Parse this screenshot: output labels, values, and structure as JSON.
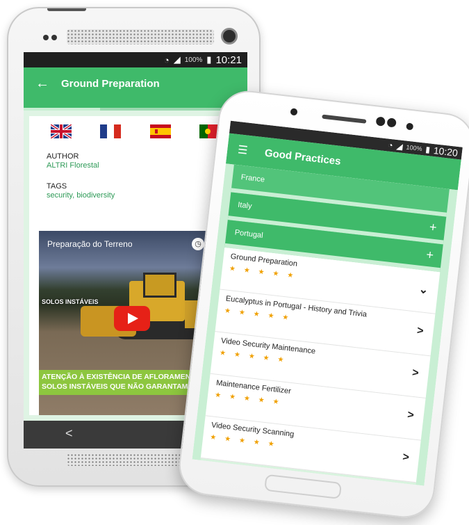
{
  "phone1": {
    "status": {
      "battery": "100%",
      "time": "10:21"
    },
    "appbar": {
      "back_icon": "arrow-left-icon",
      "title": "Ground Preparation"
    },
    "flags": [
      "uk-flag",
      "france-flag",
      "spain-flag",
      "portugal-flag"
    ],
    "author_label": "AUTHOR",
    "author_value": "ALTRI Florestal",
    "tags_label": "TAGS",
    "tags_value": "security, biodiversity",
    "video": {
      "title": "Preparação do Terreno",
      "overlay_text": "SOLOS INSTÁVEIS",
      "banner_line1": "ATENÇÃO À EXISTÊNCIA DE AFLORAMENT",
      "banner_line2": "SOLOS INSTÁVEIS QUE NÃO GARANTAM U"
    },
    "rating": 5,
    "nav_back": "<"
  },
  "phone2": {
    "status": {
      "battery": "100%",
      "time": "10:20"
    },
    "appbar": {
      "menu_icon": "hamburger-icon",
      "title": "Good Practices"
    },
    "countries": [
      {
        "name": "France",
        "sign": ""
      },
      {
        "name": "Italy",
        "sign": "+"
      },
      {
        "name": "Portugal",
        "sign": "+"
      }
    ],
    "expanded_item": {
      "name": "Ground Preparation",
      "sign": "⌄"
    },
    "practices": [
      {
        "name": "Eucalyptus in Portugal - History and Trivia"
      },
      {
        "name": "Video Security Maintenance"
      },
      {
        "name": "Maintenance Fertilizer"
      },
      {
        "name": "Video Security Scanning"
      }
    ],
    "chevron": ">"
  },
  "colors": {
    "accent": "#3fba6a",
    "star": "#f0a000",
    "link": "#2e9a57"
  }
}
